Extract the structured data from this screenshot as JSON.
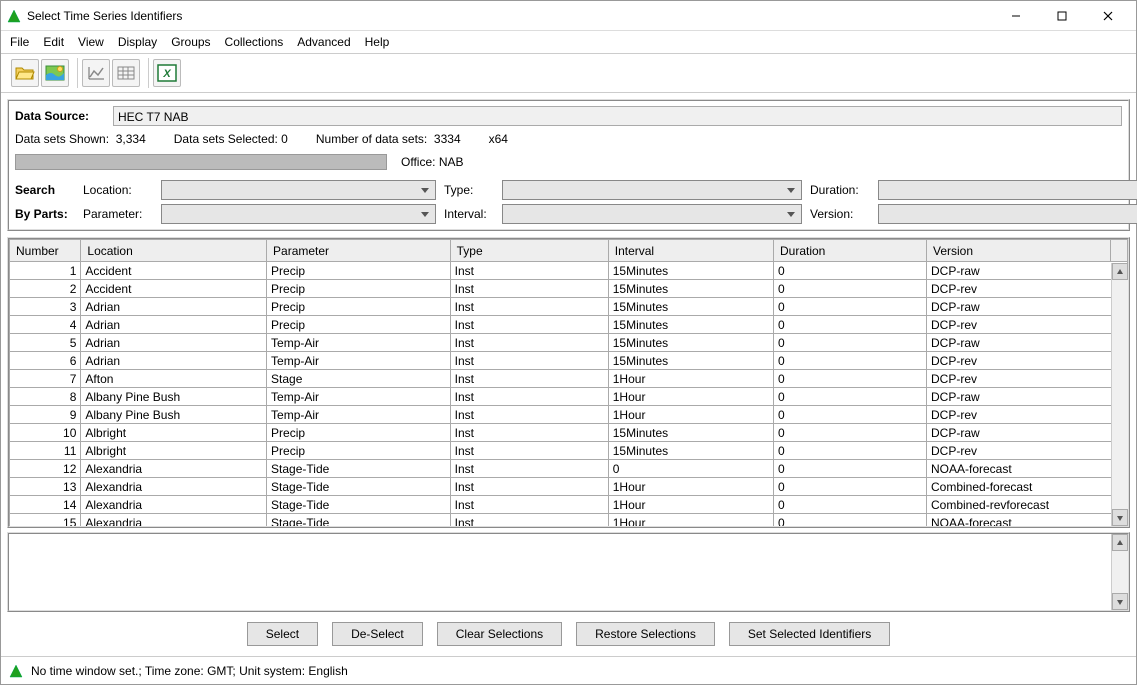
{
  "window": {
    "title": "Select Time Series Identifiers"
  },
  "menu": [
    "File",
    "Edit",
    "View",
    "Display",
    "Groups",
    "Collections",
    "Advanced",
    "Help"
  ],
  "datasource": {
    "label": "Data Source:",
    "value": "HEC T7 NAB"
  },
  "stats": {
    "shown_label": "Data sets Shown:",
    "shown_value": "3,334",
    "selected_label": "Data sets Selected:",
    "selected_value": "0",
    "number_label": "Number of data sets:",
    "number_value": "3334",
    "arch": "x64"
  },
  "office": {
    "label": "Office:",
    "value": "NAB"
  },
  "search": {
    "search_label": "Search",
    "byparts_label": "By Parts:",
    "location_label": "Location:",
    "type_label": "Type:",
    "duration_label": "Duration:",
    "parameter_label": "Parameter:",
    "interval_label": "Interval:",
    "version_label": "Version:"
  },
  "columns": [
    "Number",
    "Location",
    "Parameter",
    "Type",
    "Interval",
    "Duration",
    "Version"
  ],
  "rows": [
    {
      "n": 1,
      "loc": "Accident",
      "param": "Precip",
      "type": "Inst",
      "int": "15Minutes",
      "dur": "0",
      "ver": "DCP-raw"
    },
    {
      "n": 2,
      "loc": "Accident",
      "param": "Precip",
      "type": "Inst",
      "int": "15Minutes",
      "dur": "0",
      "ver": "DCP-rev"
    },
    {
      "n": 3,
      "loc": "Adrian",
      "param": "Precip",
      "type": "Inst",
      "int": "15Minutes",
      "dur": "0",
      "ver": "DCP-raw"
    },
    {
      "n": 4,
      "loc": "Adrian",
      "param": "Precip",
      "type": "Inst",
      "int": "15Minutes",
      "dur": "0",
      "ver": "DCP-rev"
    },
    {
      "n": 5,
      "loc": "Adrian",
      "param": "Temp-Air",
      "type": "Inst",
      "int": "15Minutes",
      "dur": "0",
      "ver": "DCP-raw"
    },
    {
      "n": 6,
      "loc": "Adrian",
      "param": "Temp-Air",
      "type": "Inst",
      "int": "15Minutes",
      "dur": "0",
      "ver": "DCP-rev"
    },
    {
      "n": 7,
      "loc": "Afton",
      "param": "Stage",
      "type": "Inst",
      "int": "1Hour",
      "dur": "0",
      "ver": "DCP-rev"
    },
    {
      "n": 8,
      "loc": "Albany Pine Bush",
      "param": "Temp-Air",
      "type": "Inst",
      "int": "1Hour",
      "dur": "0",
      "ver": "DCP-raw"
    },
    {
      "n": 9,
      "loc": "Albany Pine Bush",
      "param": "Temp-Air",
      "type": "Inst",
      "int": "1Hour",
      "dur": "0",
      "ver": "DCP-rev"
    },
    {
      "n": 10,
      "loc": "Albright",
      "param": "Precip",
      "type": "Inst",
      "int": "15Minutes",
      "dur": "0",
      "ver": "DCP-raw"
    },
    {
      "n": 11,
      "loc": "Albright",
      "param": "Precip",
      "type": "Inst",
      "int": "15Minutes",
      "dur": "0",
      "ver": "DCP-rev"
    },
    {
      "n": 12,
      "loc": "Alexandria",
      "param": "Stage-Tide",
      "type": "Inst",
      "int": "0",
      "dur": "0",
      "ver": "NOAA-forecast"
    },
    {
      "n": 13,
      "loc": "Alexandria",
      "param": "Stage-Tide",
      "type": "Inst",
      "int": "1Hour",
      "dur": "0",
      "ver": "Combined-forecast"
    },
    {
      "n": 14,
      "loc": "Alexandria",
      "param": "Stage-Tide",
      "type": "Inst",
      "int": "1Hour",
      "dur": "0",
      "ver": "Combined-revforecast"
    },
    {
      "n": 15,
      "loc": "Alexandria",
      "param": "Stage-Tide",
      "type": "Inst",
      "int": "1Hour",
      "dur": "0",
      "ver": "NOAA-forecast"
    }
  ],
  "buttons": {
    "select": "Select",
    "deselect": "De-Select",
    "clear": "Clear Selections",
    "restore": "Restore Selections",
    "set": "Set Selected Identifiers"
  },
  "status": "No time window set.;  Time zone: GMT;  Unit system: English"
}
